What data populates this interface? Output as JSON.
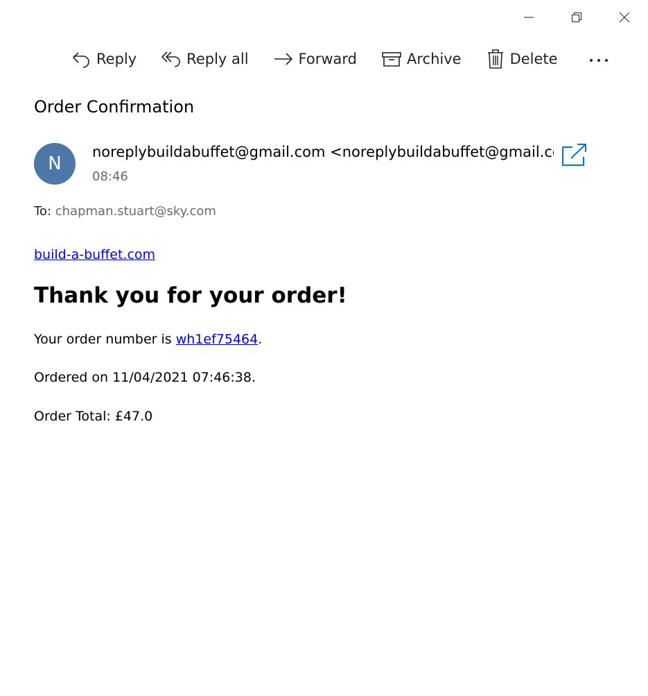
{
  "window_controls": {
    "minimize_icon": "minimize-icon",
    "restore_icon": "restore-icon",
    "close_icon": "close-icon"
  },
  "toolbar": {
    "reply_label": "Reply",
    "reply_all_label": "Reply all",
    "forward_label": "Forward",
    "archive_label": "Archive",
    "delete_label": "Delete",
    "more_icon": "more-icon"
  },
  "message": {
    "subject": "Order Confirmation",
    "avatar_initial": "N",
    "avatar_color": "#4d77a6",
    "sender_name": "noreplybuildabuffet@gmail.com",
    "sender_address": "<noreplybuildabuffet@gmail.com>",
    "time": "08:46",
    "to_label": "To:",
    "to_address": "chapman.stuart@sky.com"
  },
  "body": {
    "site_link": "build-a-buffet.com",
    "heading": "Thank you for your order!",
    "order_number_prefix": "Your order number is ",
    "order_number": "wh1ef75464",
    "order_number_suffix": ".",
    "ordered_on": "Ordered on 11/04/2021 07:46:38.",
    "order_total": "Order Total: £47.0"
  },
  "colors": {
    "link": "#0000ee",
    "accent": "#0078d4"
  }
}
